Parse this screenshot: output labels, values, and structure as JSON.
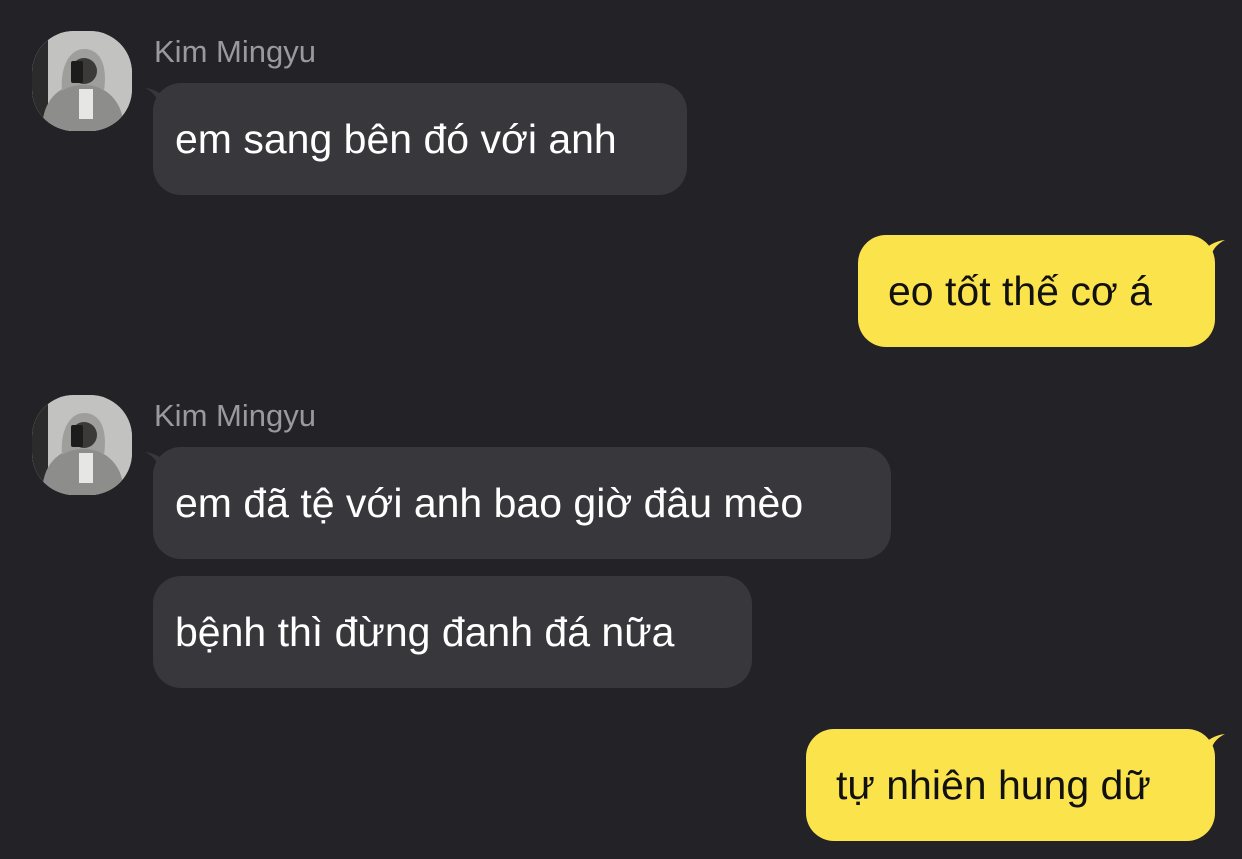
{
  "theme": {
    "background": "#232327",
    "incoming_bubble": "#38383c",
    "outgoing_bubble": "#fbe34c",
    "sender_name_color": "#9a9a9e"
  },
  "chat": {
    "groups": [
      {
        "sender": "Kim Mingyu",
        "avatar_icon": "profile-photo-mirror-selfie",
        "messages": [
          {
            "text": "em sang bên đó với anh"
          }
        ]
      },
      {
        "sender": "me",
        "messages": [
          {
            "text": "eo tốt thế cơ á"
          }
        ]
      },
      {
        "sender": "Kim Mingyu",
        "avatar_icon": "profile-photo-mirror-selfie",
        "messages": [
          {
            "text": "em đã tệ với anh bao giờ đâu mèo"
          },
          {
            "text": "bệnh thì đừng đanh đá nữa"
          }
        ]
      },
      {
        "sender": "me",
        "messages": [
          {
            "text": "tự nhiên hung dữ"
          }
        ]
      }
    ]
  }
}
